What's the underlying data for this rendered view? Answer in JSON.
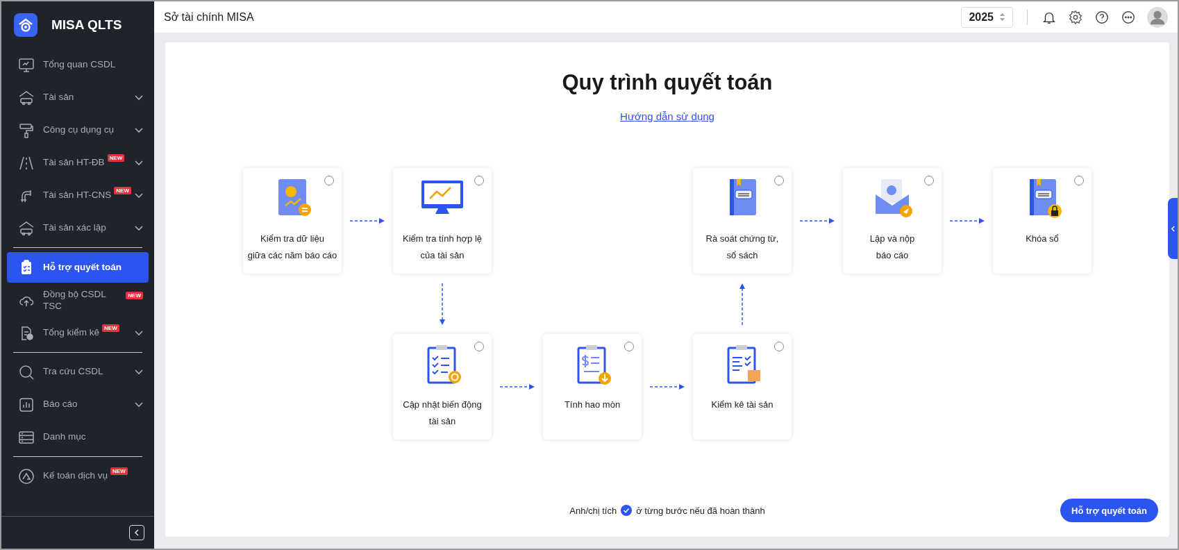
{
  "app": {
    "name": "MISA QLTS"
  },
  "sidebar": {
    "groups": [
      [
        {
          "kind": "monitor",
          "label": "Tổng quan CSDL",
          "expandable": false,
          "selected": false
        },
        {
          "kind": "house-car",
          "label": "Tài sản",
          "expandable": true,
          "selected": false
        },
        {
          "kind": "roller",
          "label": "Công cụ dụng cụ",
          "expandable": true,
          "selected": false
        },
        {
          "kind": "road",
          "label": "Tài sản HT-ĐB",
          "badge": "NEW",
          "expandable": true,
          "selected": false
        },
        {
          "kind": "pipe",
          "label": "Tài sản HT-CNS",
          "badge": "NEW",
          "expandable": true,
          "selected": false
        },
        {
          "kind": "house-car",
          "label": "Tài sản xác lập",
          "expandable": true,
          "selected": false
        }
      ],
      [
        {
          "kind": "clipboard",
          "label": "Hỗ trợ quyết toán",
          "expandable": false,
          "selected": true
        },
        {
          "kind": "cloud",
          "label": "Đồng bộ CSDL TSC",
          "badge": "NEW",
          "expandable": false,
          "selected": false
        },
        {
          "kind": "doc-check",
          "label": "Tổng kiểm kê",
          "badge": "NEW",
          "expandable": true,
          "selected": false
        }
      ],
      [
        {
          "kind": "search",
          "label": "Tra cứu CSDL",
          "expandable": true,
          "selected": false
        },
        {
          "kind": "chart",
          "label": "Báo cáo",
          "expandable": true,
          "selected": false
        },
        {
          "kind": "list",
          "label": "Danh mục",
          "expandable": false,
          "selected": false
        }
      ],
      [
        {
          "kind": "triangle",
          "label": "Kế toán dịch vụ",
          "badge": "NEW",
          "expandable": false,
          "selected": false
        }
      ]
    ]
  },
  "header": {
    "title": "Sở tài chính MISA",
    "year": "2025"
  },
  "process": {
    "title": "Quy trình quyết toán",
    "guide_link": "Hướng dẫn sử dụng",
    "steps": [
      {
        "kind": "notebook",
        "label": "Kiểm tra dữ liệu\ngiữa các năm báo cáo",
        "checked": false
      },
      {
        "kind": "monitor",
        "label": "Kiểm tra tính hợp lệ\ncủa tài sản",
        "checked": false
      },
      {
        "kind": "book",
        "label": "Rà soát chứng từ,\nsổ sách",
        "checked": false
      },
      {
        "kind": "envelope",
        "label": "Lập và nộp\nbáo cáo",
        "checked": false
      },
      {
        "kind": "book-lock",
        "label": "Khóa sổ",
        "checked": false
      },
      {
        "kind": "clipboard-sync",
        "label": "Cập nhật biến động\ntài sản",
        "checked": false
      },
      {
        "kind": "clipboard-money",
        "label": "Tính hao mòn",
        "checked": false
      },
      {
        "kind": "clipboard-box",
        "label": "Kiểm kê tài sản",
        "checked": false
      }
    ],
    "hint_before": "Anh/chị tích",
    "hint_after": "ở từng bước nếu đã hoàn thành",
    "action": "Hỗ trợ quyết toán"
  }
}
